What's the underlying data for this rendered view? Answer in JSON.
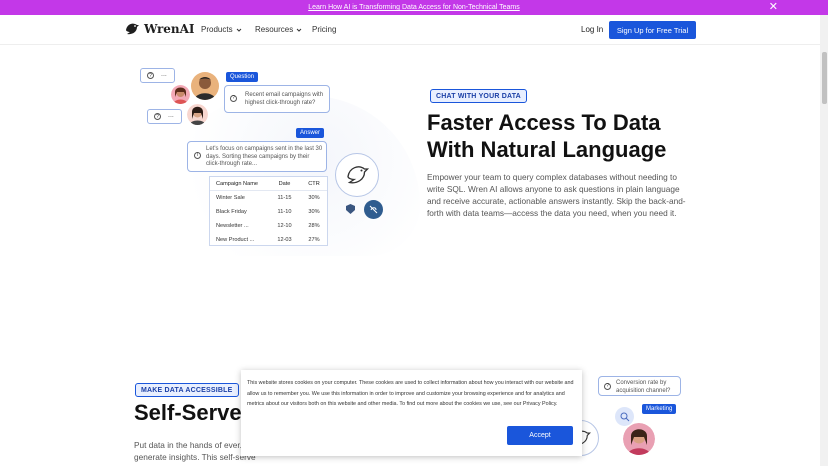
{
  "announcement": {
    "text": "Learn How AI is Transforming Data Access for Non-Technical Teams"
  },
  "nav": {
    "logo": "WrenAI",
    "items": [
      "Products",
      "Resources",
      "Pricing"
    ],
    "login": "Log In",
    "signup": "Sign Up for Free Trial"
  },
  "hero": {
    "tag": "CHAT WITH YOUR DATA",
    "title_line1": "Faster Access To Data",
    "title_line2": "With Natural Language",
    "description": "Empower your team to query complex databases without needing to write SQL. Wren AI allows anyone to ask questions in plain language and receive accurate, actionable answers instantly. Skip the back-and-forth with data teams—access the data you need, when you need it."
  },
  "illustration": {
    "dots": "...",
    "question_label": "Question",
    "question_text": "Recent email campaigns with highest click-through rate?",
    "answer_label": "Answer",
    "answer_text": "Let's focus on campaigns sent in the last 30 days. Sorting these campaigns by their click-through rate...",
    "table": {
      "headers": [
        "Campaign Name",
        "Date",
        "CTR"
      ],
      "rows": [
        [
          "Winter Sale",
          "11-15",
          "30%"
        ],
        [
          "Black Friday",
          "11-10",
          "30%"
        ],
        [
          "Newsletter ...",
          "12-10",
          "28%"
        ],
        [
          "New Product ...",
          "12-03",
          "27%"
        ]
      ]
    }
  },
  "section2": {
    "tag": "MAKE DATA ACCESSIBLE",
    "title": "Self-Serve",
    "description": "Put data in the hands of ever... independently explore data and generate insights. This self-serve",
    "question_text": "Conversion rate by acquisition channel?",
    "marketing_label": "Marketing"
  },
  "cookie": {
    "text": "This website stores cookies on your computer. These cookies are used to collect information about how you interact with our website and allow us to remember you. We use this information in order to improve and customize your browsing experience and for analytics and metrics about our visitors both on this website and other media. To find out more about the cookies we use, see our Privacy Policy.",
    "accept": "Accept"
  },
  "colors": {
    "brand": "#1a56db",
    "announcement": "#c338e8"
  }
}
